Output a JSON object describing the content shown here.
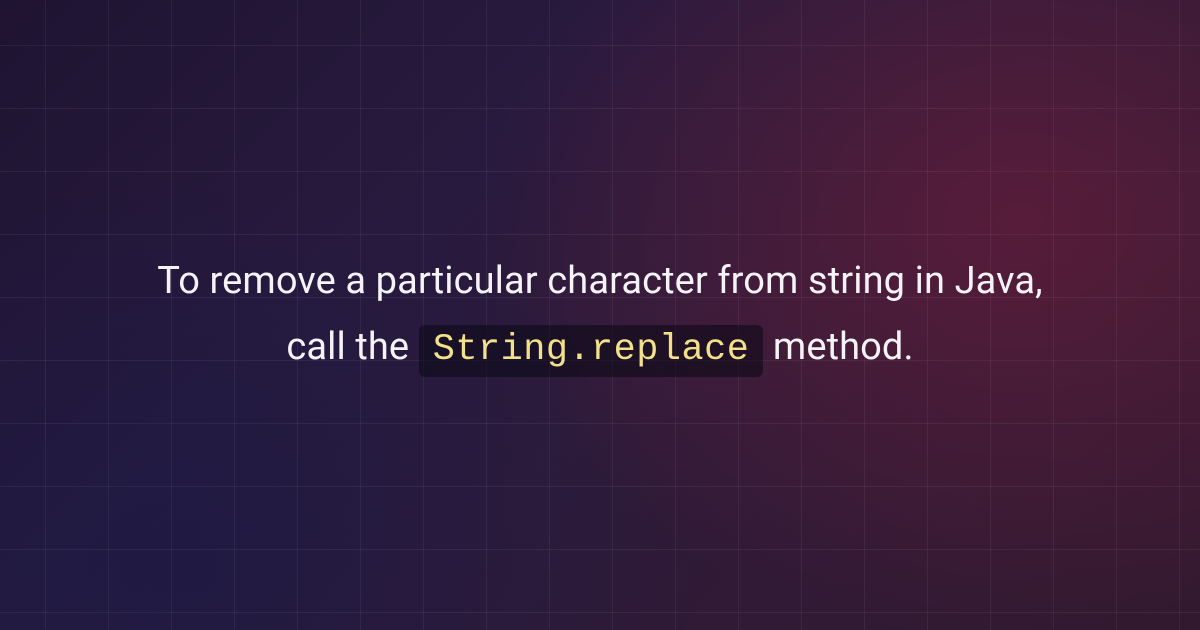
{
  "main": {
    "text_before": "To remove a particular character from string in Java, call the ",
    "code": "String.replace",
    "text_after": " method."
  }
}
